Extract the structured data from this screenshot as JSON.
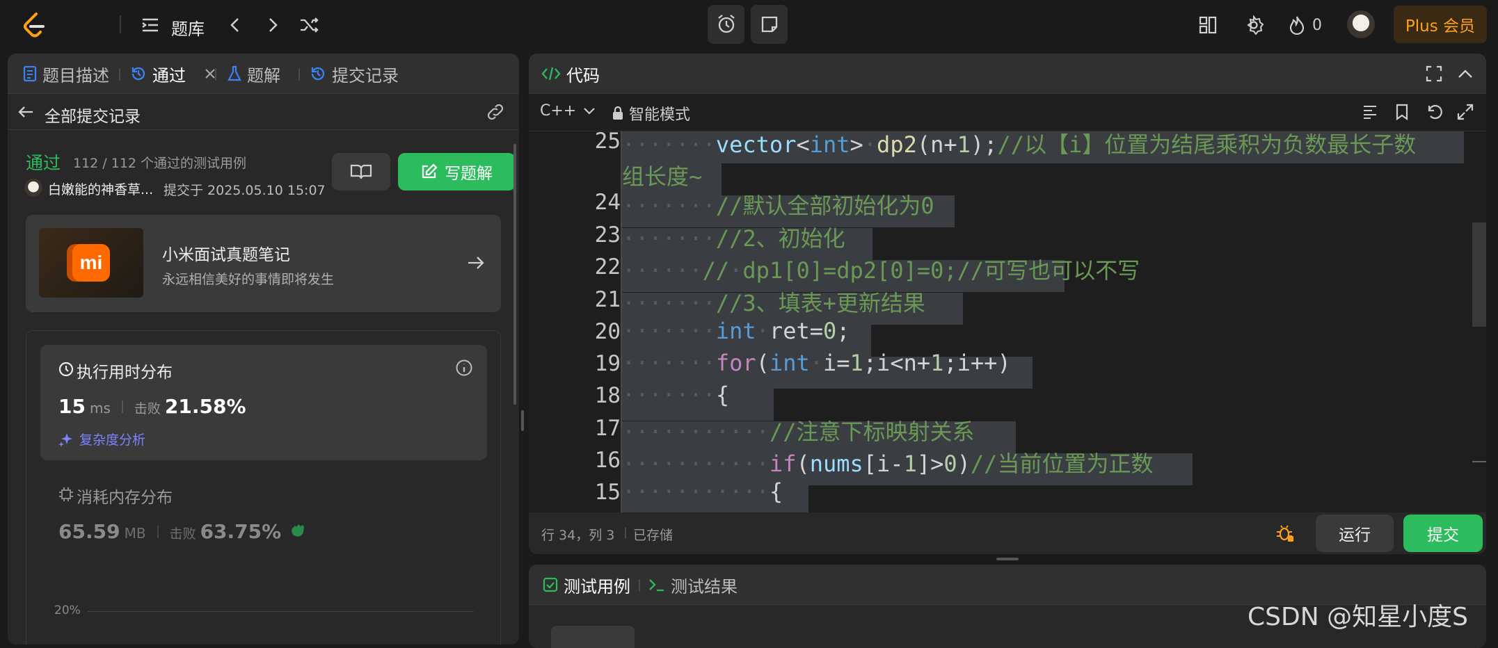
{
  "topbar": {
    "problem_bank": "题库",
    "streak_count": "0",
    "plus_label": "Plus 会员"
  },
  "left_panel": {
    "tabs": [
      {
        "label": "题目描述"
      },
      {
        "label": "通过"
      },
      {
        "label": "题解"
      },
      {
        "label": "提交记录"
      }
    ],
    "back_label": "全部提交记录",
    "status": "通过",
    "cases_text": "112 / 112 个通过的测试用例",
    "user_name": "白嫩能的神香草...",
    "submitted_at": "提交于 2025.05.10 15:07",
    "write_solution_label": "写题解",
    "promo": {
      "title": "小米面试真题笔记",
      "subtitle": "永远相信美好的事情即将发生",
      "logo_text": "mi"
    },
    "runtime": {
      "title": "执行用时分布",
      "value": "15",
      "unit": "ms",
      "beats_label": "击败",
      "beats_value": "21.58%",
      "analysis_label": "复杂度分析"
    },
    "memory": {
      "title": "消耗内存分布",
      "value": "65.59",
      "unit": "MB",
      "beats_label": "击败",
      "beats_value": "63.75%"
    },
    "chart_tick": "20%"
  },
  "code_panel": {
    "title": "代码",
    "language": "C++",
    "mode": "智能模式",
    "status_position": "行 34，列 3",
    "status_saved": "已存储",
    "run_label": "运行",
    "submit_label": "提交",
    "line_numbers": [
      "25",
      "",
      "24",
      "23",
      "22",
      "21",
      "20",
      "19",
      "18",
      "17",
      "16",
      "15"
    ]
  },
  "bottom_panel": {
    "tab_testcase": "测试用例",
    "tab_result": "测试结果"
  },
  "watermark": "CSDN @知星小度S",
  "colors": {
    "accent_green": "#2cbb5d",
    "plus_gold": "#ffa116",
    "link_blue": "#3b82f6"
  }
}
